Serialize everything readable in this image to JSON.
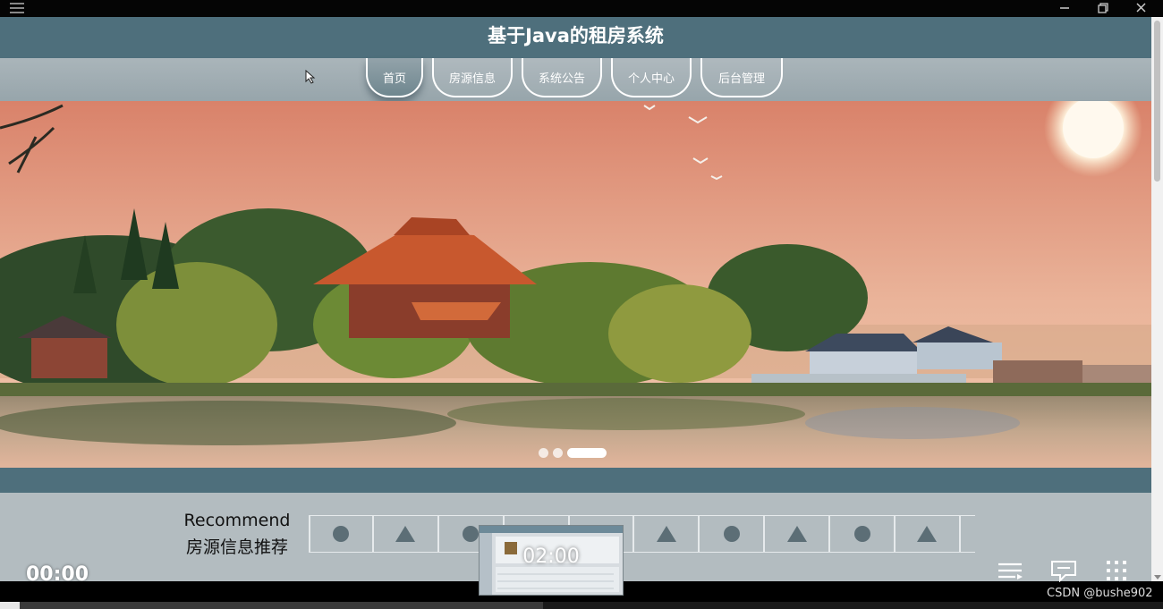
{
  "app": {
    "title": "基于Java的租房系统",
    "nav": [
      "首页",
      "房源信息",
      "系统公告",
      "个人中心",
      "后台管理"
    ],
    "active_nav": "首页"
  },
  "recommend": {
    "title_en": "Recommend",
    "title_cn": "房源信息推荐",
    "tabs": [
      "circle",
      "triangle",
      "circle",
      "triangle",
      "circle",
      "triangle",
      "circle",
      "triangle",
      "circle",
      "triangle"
    ]
  },
  "video": {
    "current_time": "00:00",
    "preview_time": "02:00",
    "progress_fraction": 0.017,
    "buffered_fraction": 0.467
  },
  "credit": "CSDN @bushe902",
  "icons": {
    "window_menu": "hamburger-icon",
    "minimize": "minimize-icon",
    "restore": "restore-icon",
    "close": "close-icon",
    "playlist": "playlist-icon",
    "danmaku": "comment-icon",
    "grid": "grid-icon"
  },
  "colors": {
    "header": "#4e6f7c",
    "nav_band": "#9aa8ae",
    "shape": "#5c6e76"
  }
}
